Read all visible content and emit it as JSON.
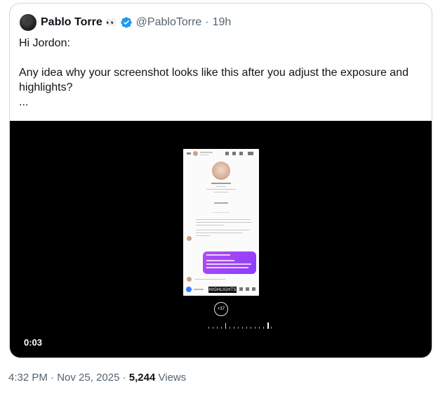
{
  "tweet": {
    "author_name": "Pablo Torre",
    "author_emoji": "👀",
    "handle": "@PabloTorre",
    "separator": "·",
    "age": "19h",
    "greeting": "Hi Jordon:",
    "body": "Any idea why your screenshot looks like this after you adjust the exposure and highlights?",
    "ellipsis": "..."
  },
  "media": {
    "timecode": "0:03",
    "overlay_label": "HIGHLIGHTS",
    "dial_value": "+37"
  },
  "meta": {
    "time": "4:32 PM",
    "separator": "·",
    "date": "Nov 25, 2025",
    "views_count": "5,244",
    "views_label": "Views"
  },
  "colors": {
    "verified_badge": "#1d9bf0",
    "secondary_text": "#536471",
    "border": "#cfd9de",
    "bubble": "#9b45f5"
  }
}
